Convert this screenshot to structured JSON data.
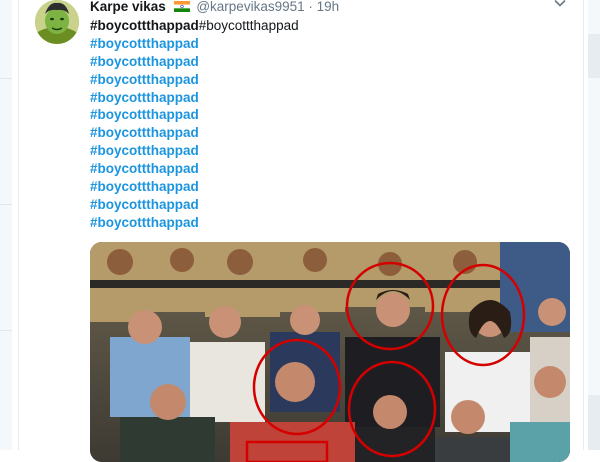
{
  "tweet": {
    "author_name": "Karpe vikas",
    "handle": "@karpevikas9951",
    "separator": "·",
    "time": "19h",
    "first_line": {
      "bold": "#boycottthappad",
      "plain": "#boycottthappad"
    },
    "hashtags": [
      "#boycottthappad",
      "#boycottthappad",
      "#boycottthappad",
      "#boycottthappad",
      "#boycottthappad",
      "#boycottthappad",
      "#boycottthappad",
      "#boycottthappad",
      "#boycottthappad",
      "#boycottthappad",
      "#boycottthappad"
    ],
    "icons": {
      "flag": "india-flag-icon",
      "menu": "chevron-down-icon"
    }
  },
  "colors": {
    "hashtag": "#1b95e0",
    "name": "#14171a",
    "muted": "#657786",
    "highlight_circle": "#d40000"
  }
}
